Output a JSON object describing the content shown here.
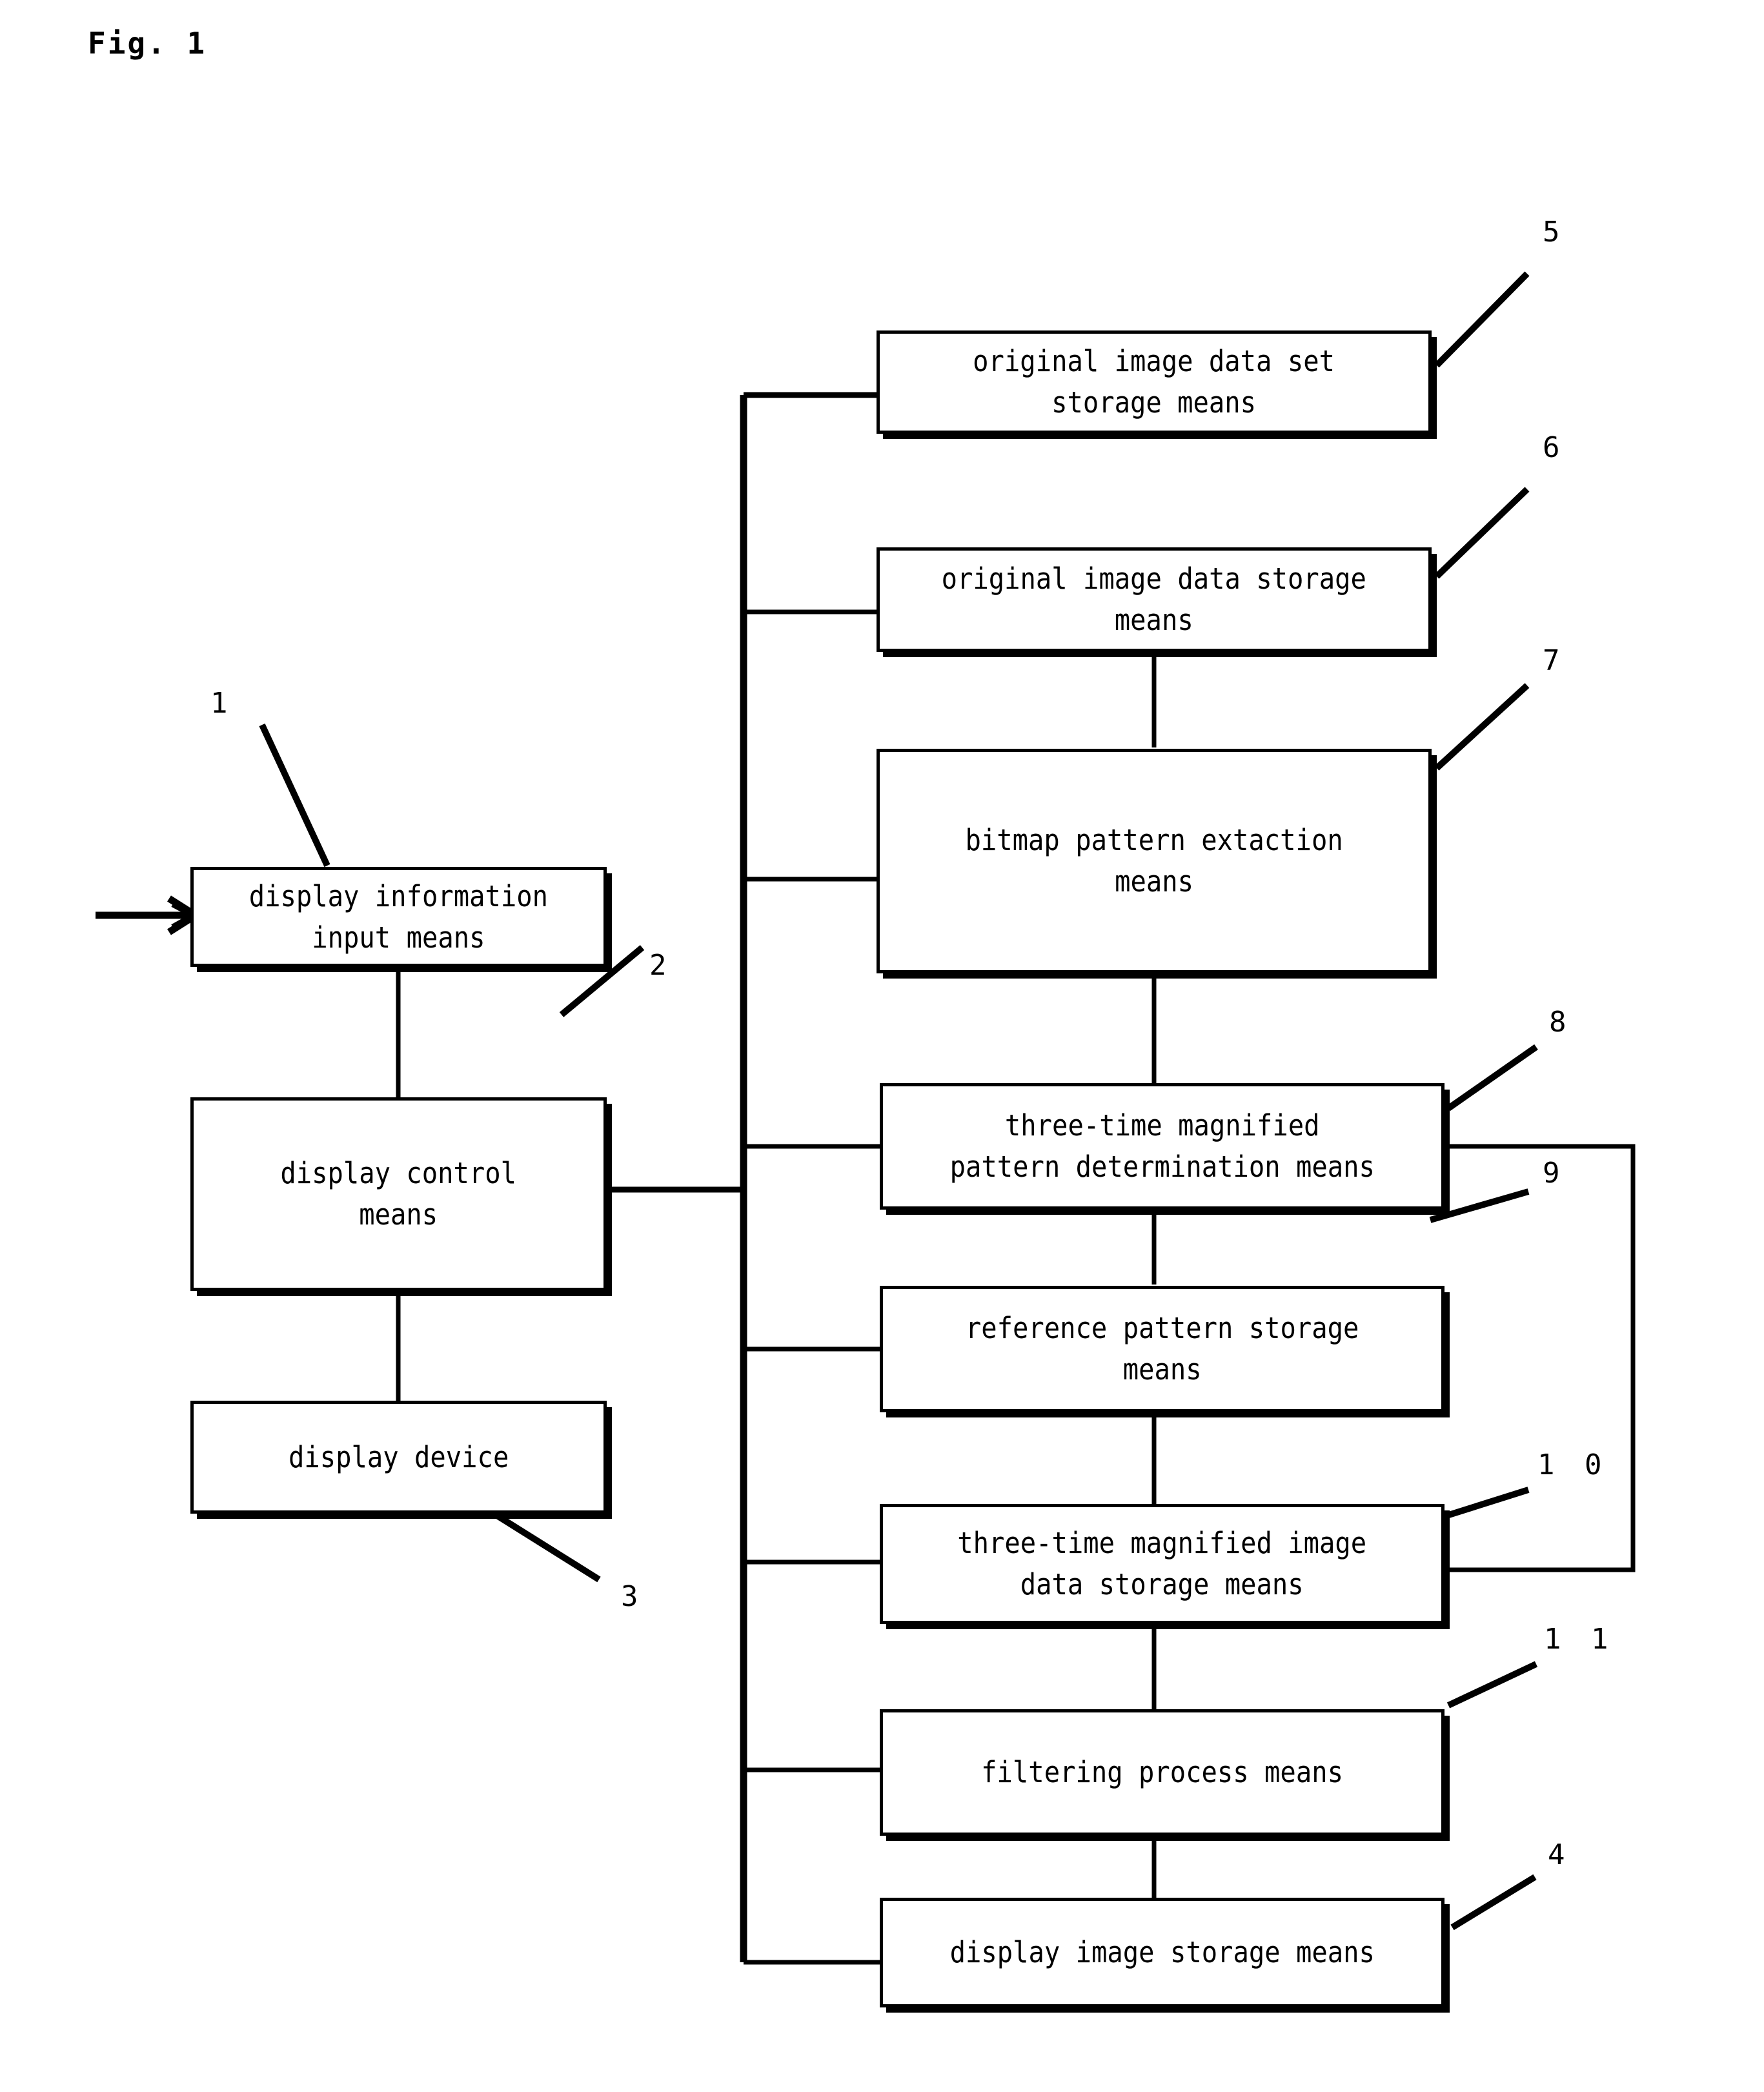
{
  "figure": {
    "label": "Fig. 1"
  },
  "nodes": {
    "display_information_input_means": {
      "text": "display information\ninput means",
      "ref": "1"
    },
    "display_control_means": {
      "text": "display control\nmeans",
      "ref": "2"
    },
    "display_device": {
      "text": "display device",
      "ref": "3"
    },
    "original_image_data_set_storage_means": {
      "text": "original image data set\nstorage means",
      "ref": "5"
    },
    "original_image_data_storage_means": {
      "text": "original image data storage\nmeans",
      "ref": "6"
    },
    "bitmap_pattern_extaction_means": {
      "text": "bitmap pattern extaction\nmeans",
      "ref": "7"
    },
    "three_time_magnified_pattern_determination_means": {
      "text": "three-time magnified\npattern determination means",
      "ref": "8"
    },
    "reference_pattern_storage_means": {
      "text": "reference pattern storage\nmeans",
      "ref": "9"
    },
    "three_time_magnified_image_data_storage_means": {
      "text": "three-time magnified image\ndata storage means",
      "ref": "1 0"
    },
    "filtering_process_means": {
      "text": "filtering process means",
      "ref": "1 1"
    },
    "display_image_storage_means": {
      "text": "display image storage means",
      "ref": "4"
    }
  },
  "refnums": {
    "n1": "1",
    "n2": "2",
    "n3": "3",
    "n4": "4",
    "n5": "5",
    "n6": "6",
    "n7": "7",
    "n8": "8",
    "n9": "9",
    "n10": "1 0",
    "n11": "1 1"
  },
  "colors": {
    "ink": "#000000",
    "paper": "#ffffff"
  }
}
